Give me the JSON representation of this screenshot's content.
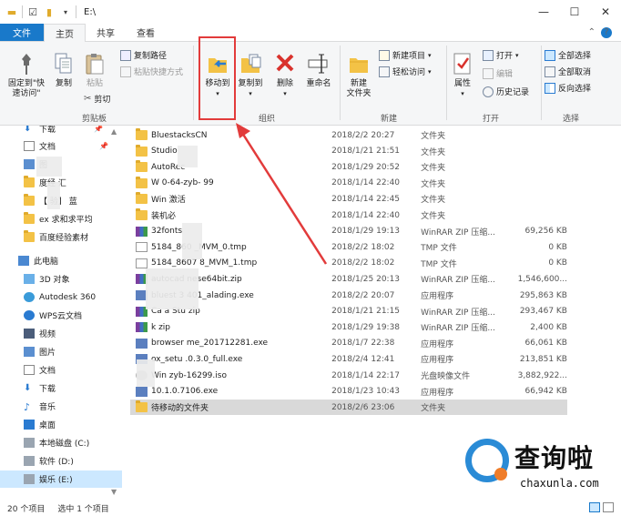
{
  "window": {
    "title": "E:\\",
    "minimize": "—",
    "maximize": "☐",
    "close": "✕"
  },
  "tabs": [
    {
      "label": "文件"
    },
    {
      "label": "主页"
    },
    {
      "label": "共享"
    },
    {
      "label": "查看"
    }
  ],
  "ribbon": {
    "clipboard": {
      "pin": "固定到\"快\n速访问\"",
      "copy": "复制",
      "paste": "粘贴",
      "copy_path": "复制路径",
      "paste_shortcut": "粘贴快捷方式",
      "cut": "剪切",
      "group": "剪贴板"
    },
    "organize": {
      "move_to": "移动到",
      "copy_to": "复制到",
      "delete": "删除",
      "rename": "重命名",
      "group": "组织"
    },
    "new": {
      "new_folder": "新建\n文件夹",
      "new_item": "新建项目",
      "easy_access": "轻松访问",
      "group": "新建"
    },
    "open": {
      "properties": "属性",
      "open": "打开",
      "edit": "编辑",
      "history": "历史记录",
      "group": "打开"
    },
    "select": {
      "select_all": "全部选择",
      "select_none": "全部取消",
      "invert": "反向选择",
      "group": "选择"
    }
  },
  "nav": {
    "items": [
      {
        "label": "下载",
        "pinned": true
      },
      {
        "label": "文档",
        "pinned": true
      },
      {
        "label": "图",
        "pinned": true
      },
      {
        "label": "度经 汇"
      },
      {
        "label": "【 验】 蓝"
      },
      {
        "label": "ex 求和求平均"
      },
      {
        "label": "百度经验素材"
      },
      {
        "label": "此电脑"
      },
      {
        "label": "3D 对象"
      },
      {
        "label": "Autodesk 360"
      },
      {
        "label": "WPS云文档"
      },
      {
        "label": "视频"
      },
      {
        "label": "图片"
      },
      {
        "label": "文档"
      },
      {
        "label": "下载"
      },
      {
        "label": "音乐"
      },
      {
        "label": "桌面"
      },
      {
        "label": "本地磁盘 (C:)"
      },
      {
        "label": "软件 (D:)"
      },
      {
        "label": "娱乐 (E:)"
      }
    ]
  },
  "files": [
    {
      "name": "BluestacksCN",
      "date": "2018/2/2 20:27",
      "type": "文件夹",
      "size": "",
      "icon": "folder"
    },
    {
      "name": "Studio",
      "date": "2018/1/21 21:51",
      "type": "文件夹",
      "size": "",
      "icon": "folder"
    },
    {
      "name": "AutoRec",
      "date": "2018/1/29 20:52",
      "type": "文件夹",
      "size": "",
      "icon": "folder"
    },
    {
      "name": "W 0-64-zyb- 99",
      "date": "2018/1/14 22:40",
      "type": "文件夹",
      "size": "",
      "icon": "folder"
    },
    {
      "name": "Win 激活",
      "date": "2018/1/14 22:45",
      "type": "文件夹",
      "size": "",
      "icon": "folder"
    },
    {
      "name": "装机必",
      "date": "2018/1/14 22:40",
      "type": "文件夹",
      "size": "",
      "icon": "folder"
    },
    {
      "name": "32fonts",
      "date": "2018/1/29 19:13",
      "type": "WinRAR ZIP 压缩...",
      "size": "69,256 KB",
      "icon": "rar"
    },
    {
      "name": "5184_860 _MVM_0.tmp",
      "date": "2018/2/2 18:02",
      "type": "TMP 文件",
      "size": "0 KB",
      "icon": "tmp"
    },
    {
      "name": "5184_8607 8_MVM_1.tmp",
      "date": "2018/2/2 18:02",
      "type": "TMP 文件",
      "size": "0 KB",
      "icon": "tmp"
    },
    {
      "name": "autocad nese64bit.zip",
      "date": "2018/1/25 20:13",
      "type": "WinRAR ZIP 压缩...",
      "size": "1,546,600...",
      "icon": "rar"
    },
    {
      "name": "bluest 3 401_alading.exe",
      "date": "2018/2/2 20:07",
      "type": "应用程序",
      "size": "295,863 KB",
      "icon": "exe"
    },
    {
      "name": "Ca a Stu zip",
      "date": "2018/1/21 21:15",
      "type": "WinRAR ZIP 压缩...",
      "size": "293,467 KB",
      "icon": "rar"
    },
    {
      "name": "k zip",
      "date": "2018/1/29 19:38",
      "type": "WinRAR ZIP 压缩...",
      "size": "2,400 KB",
      "icon": "rar"
    },
    {
      "name": "browser me_201712281.exe",
      "date": "2018/1/7 22:38",
      "type": "应用程序",
      "size": "66,061 KB",
      "icon": "exe"
    },
    {
      "name": "ox_setu .0.3.0_full.exe",
      "date": "2018/2/4 12:41",
      "type": "应用程序",
      "size": "213,851 KB",
      "icon": "exe"
    },
    {
      "name": "Win zyb-16299.iso",
      "date": "2018/1/14 22:17",
      "type": "光盘映像文件",
      "size": "3,882,922...",
      "icon": "iso"
    },
    {
      "name": "10.1.0.7106.exe",
      "date": "2018/1/23 10:43",
      "type": "应用程序",
      "size": "66,942 KB",
      "icon": "exe"
    },
    {
      "name": "待移动的文件夹",
      "date": "2018/2/6 23:06",
      "type": "文件夹",
      "size": "",
      "icon": "folder",
      "selected": true
    }
  ],
  "status": {
    "count": "20 个项目",
    "selected": "选中 1 个项目"
  },
  "watermark": {
    "title": "查询啦",
    "url": "chaxunla.com"
  },
  "colors": {
    "accent": "#1979ca",
    "highlight": "#e23b3b",
    "folder": "#f3c246"
  }
}
